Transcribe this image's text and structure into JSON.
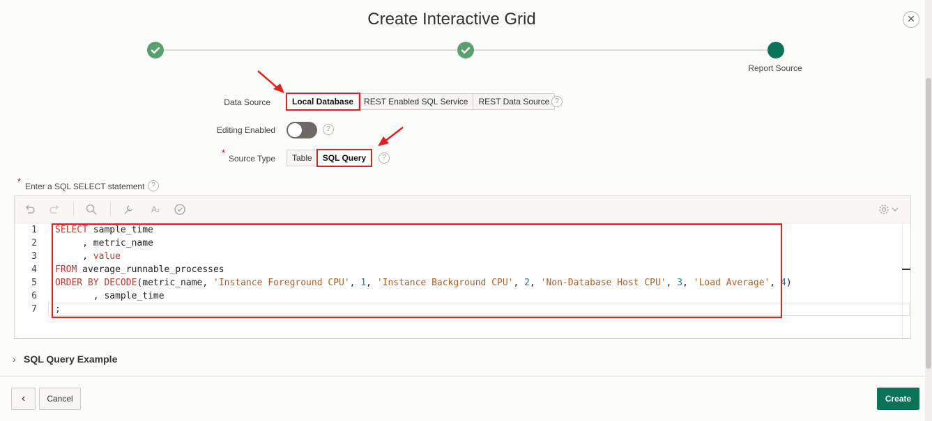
{
  "dialog": {
    "title": "Create Interactive Grid",
    "close_glyph": "✕"
  },
  "wizard": {
    "current_step_label": "Report Source"
  },
  "form": {
    "data_source": {
      "label": "Data Source",
      "options": [
        "Local Database",
        "REST Enabled SQL Service",
        "REST Data Source"
      ],
      "selected": "Local Database"
    },
    "editing_enabled": {
      "label": "Editing Enabled",
      "on": false
    },
    "source_type": {
      "label": "Source Type",
      "required_mark": "*",
      "options": [
        "Table",
        "SQL Query"
      ],
      "selected": "SQL Query"
    },
    "sql": {
      "label": "Enter a SQL SELECT statement",
      "required_mark": "*",
      "line_numbers": [
        "1",
        "2",
        "3",
        "4",
        "5",
        "6",
        "7"
      ]
    },
    "help_glyph": "?"
  },
  "editor_toolbar": {
    "icons": [
      "undo-icon",
      "redo-icon",
      "search-icon",
      "wrench-icon",
      "text-case-icon",
      "check-circle-icon",
      "gear-icon",
      "chevron-down-icon"
    ]
  },
  "example": {
    "label": "SQL Query Example",
    "chevron": "›"
  },
  "footer": {
    "back_glyph": "‹",
    "cancel_label": "Cancel",
    "create_label": "Create"
  },
  "colors": {
    "accent": "#0a7356",
    "done_step": "#5aa06e",
    "highlight": "#e3201b"
  }
}
